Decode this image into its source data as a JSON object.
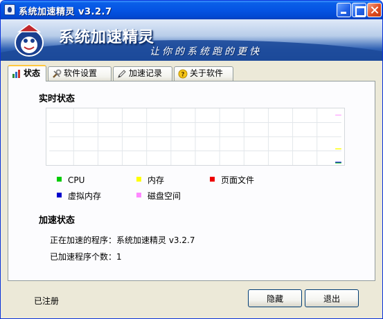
{
  "window": {
    "title": "系统加速精灵 v3.2.7"
  },
  "banner": {
    "title": "系统加速精灵",
    "slogan": "让你的系统跑的更快"
  },
  "tabs": [
    {
      "label": "状态",
      "icon": "status-icon",
      "active": true
    },
    {
      "label": "软件设置",
      "icon": "tools-icon",
      "active": false
    },
    {
      "label": "加速记录",
      "icon": "pencil-icon",
      "active": false
    },
    {
      "label": "关于软件",
      "icon": "help-icon",
      "active": false
    }
  ],
  "realtime": {
    "title": "实时状态",
    "legend": [
      {
        "label": "CPU",
        "color": "#00cc00"
      },
      {
        "label": "内存",
        "color": "#ffff00"
      },
      {
        "label": "页面文件",
        "color": "#ee0000"
      },
      {
        "label": "虚拟内存",
        "color": "#0000cc"
      },
      {
        "label": "磁盘空间",
        "color": "#ff88ff"
      }
    ]
  },
  "acceleration": {
    "title": "加速状态",
    "current_program": "正在加速的程序：系统加速精灵 v3.2.7",
    "count": "已加速程序个数：1"
  },
  "footer": {
    "status": "已注册",
    "hide_label": "隐藏",
    "exit_label": "退出"
  },
  "colors": {
    "titlebar": "#0554e3",
    "tab_highlight": "#ffc73c",
    "window_bg": "#ece9d8"
  }
}
